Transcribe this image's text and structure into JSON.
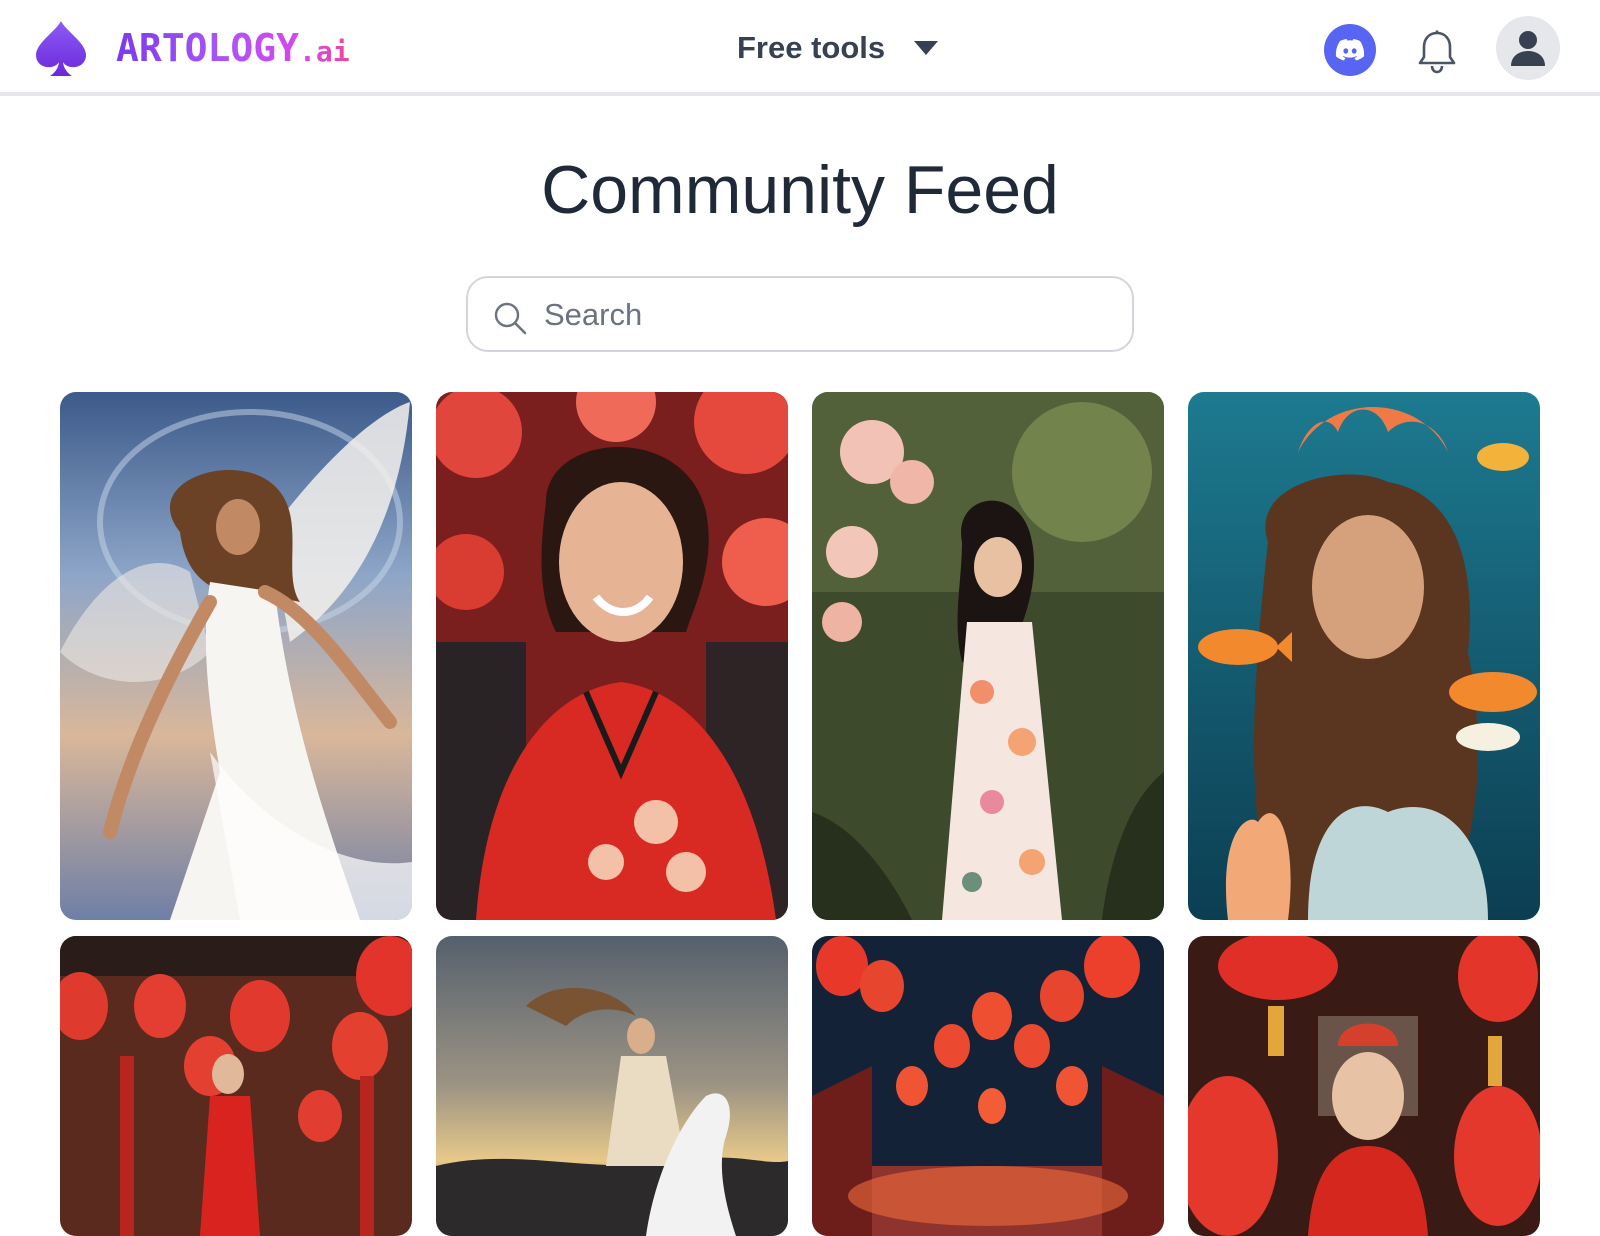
{
  "header": {
    "brand_name": "ARTOLOGY",
    "brand_suffix": ".ai",
    "logo_icon": "spade-icon",
    "menu_label": "Free tools",
    "menu_icon": "caret-down-icon",
    "discord_icon": "discord-icon",
    "notifications_icon": "bell-icon",
    "profile_icon": "user-icon",
    "brand_color": "#7c3aed",
    "discord_color": "#5865f2"
  },
  "main": {
    "title": "Community Feed",
    "search": {
      "placeholder": "Search",
      "value": "",
      "icon": "search-icon"
    },
    "feed": [
      {
        "id": "angel-white-dress",
        "row": 1,
        "col": 1
      },
      {
        "id": "woman-red-qipao-lanterns",
        "row": 1,
        "col": 2
      },
      {
        "id": "woman-floral-dress-garden",
        "row": 1,
        "col": 3
      },
      {
        "id": "woman-underwater-fish",
        "row": 1,
        "col": 4
      },
      {
        "id": "woman-red-dress-temple",
        "row": 2,
        "col": 1
      },
      {
        "id": "woman-riding-white-horse",
        "row": 2,
        "col": 2
      },
      {
        "id": "red-lanterns-night",
        "row": 2,
        "col": 3
      },
      {
        "id": "bride-red-lanterns",
        "row": 2,
        "col": 4
      }
    ]
  }
}
